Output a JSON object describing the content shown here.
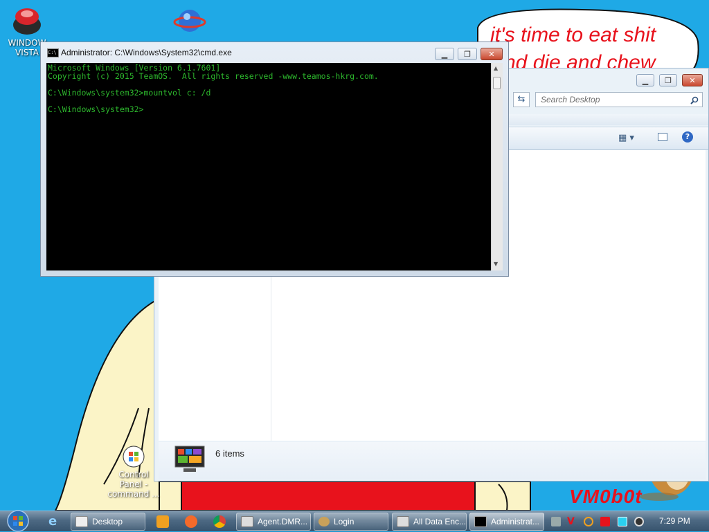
{
  "wallpaper": {
    "speech_line1": "it's time to eat shit",
    "speech_line2": "nd die and chew",
    "signature": "VM0b0t"
  },
  "desktop_icons": [
    {
      "label_line1": "WINDOW",
      "label_line2": "VISTA"
    },
    {
      "label_line1": "Control Panel -",
      "label_line2": "command ..."
    }
  ],
  "explorer": {
    "search_placeholder": "Search Desktop",
    "item_count": "6 items"
  },
  "cmd": {
    "title": "Administrator: C:\\Windows\\System32\\cmd.exe",
    "lines": [
      "Microsoft Windows [Version 6.1.7601]",
      "Copyright (c) 2015 TeamOS.  All rights reserved -www.teamos-hkrg.com.",
      "",
      "C:\\Windows\\system32>mountvol c: /d",
      "",
      "C:\\Windows\\system32>"
    ]
  },
  "taskbar": {
    "items": [
      {
        "label": "Desktop",
        "icon": "desktop-icon"
      },
      {
        "label": "Agent.DMR...",
        "icon": "window-icon"
      },
      {
        "label": "Login",
        "icon": "login-icon"
      },
      {
        "label": "All Data Enc...",
        "icon": "window-icon"
      },
      {
        "label": "Administrat...",
        "icon": "cmd-icon"
      }
    ],
    "clock": "7:29 PM"
  },
  "colors": {
    "desktop_bg": "#1fa9e6",
    "speech_text": "#e8121c",
    "cmd_text": "#2db82d"
  }
}
